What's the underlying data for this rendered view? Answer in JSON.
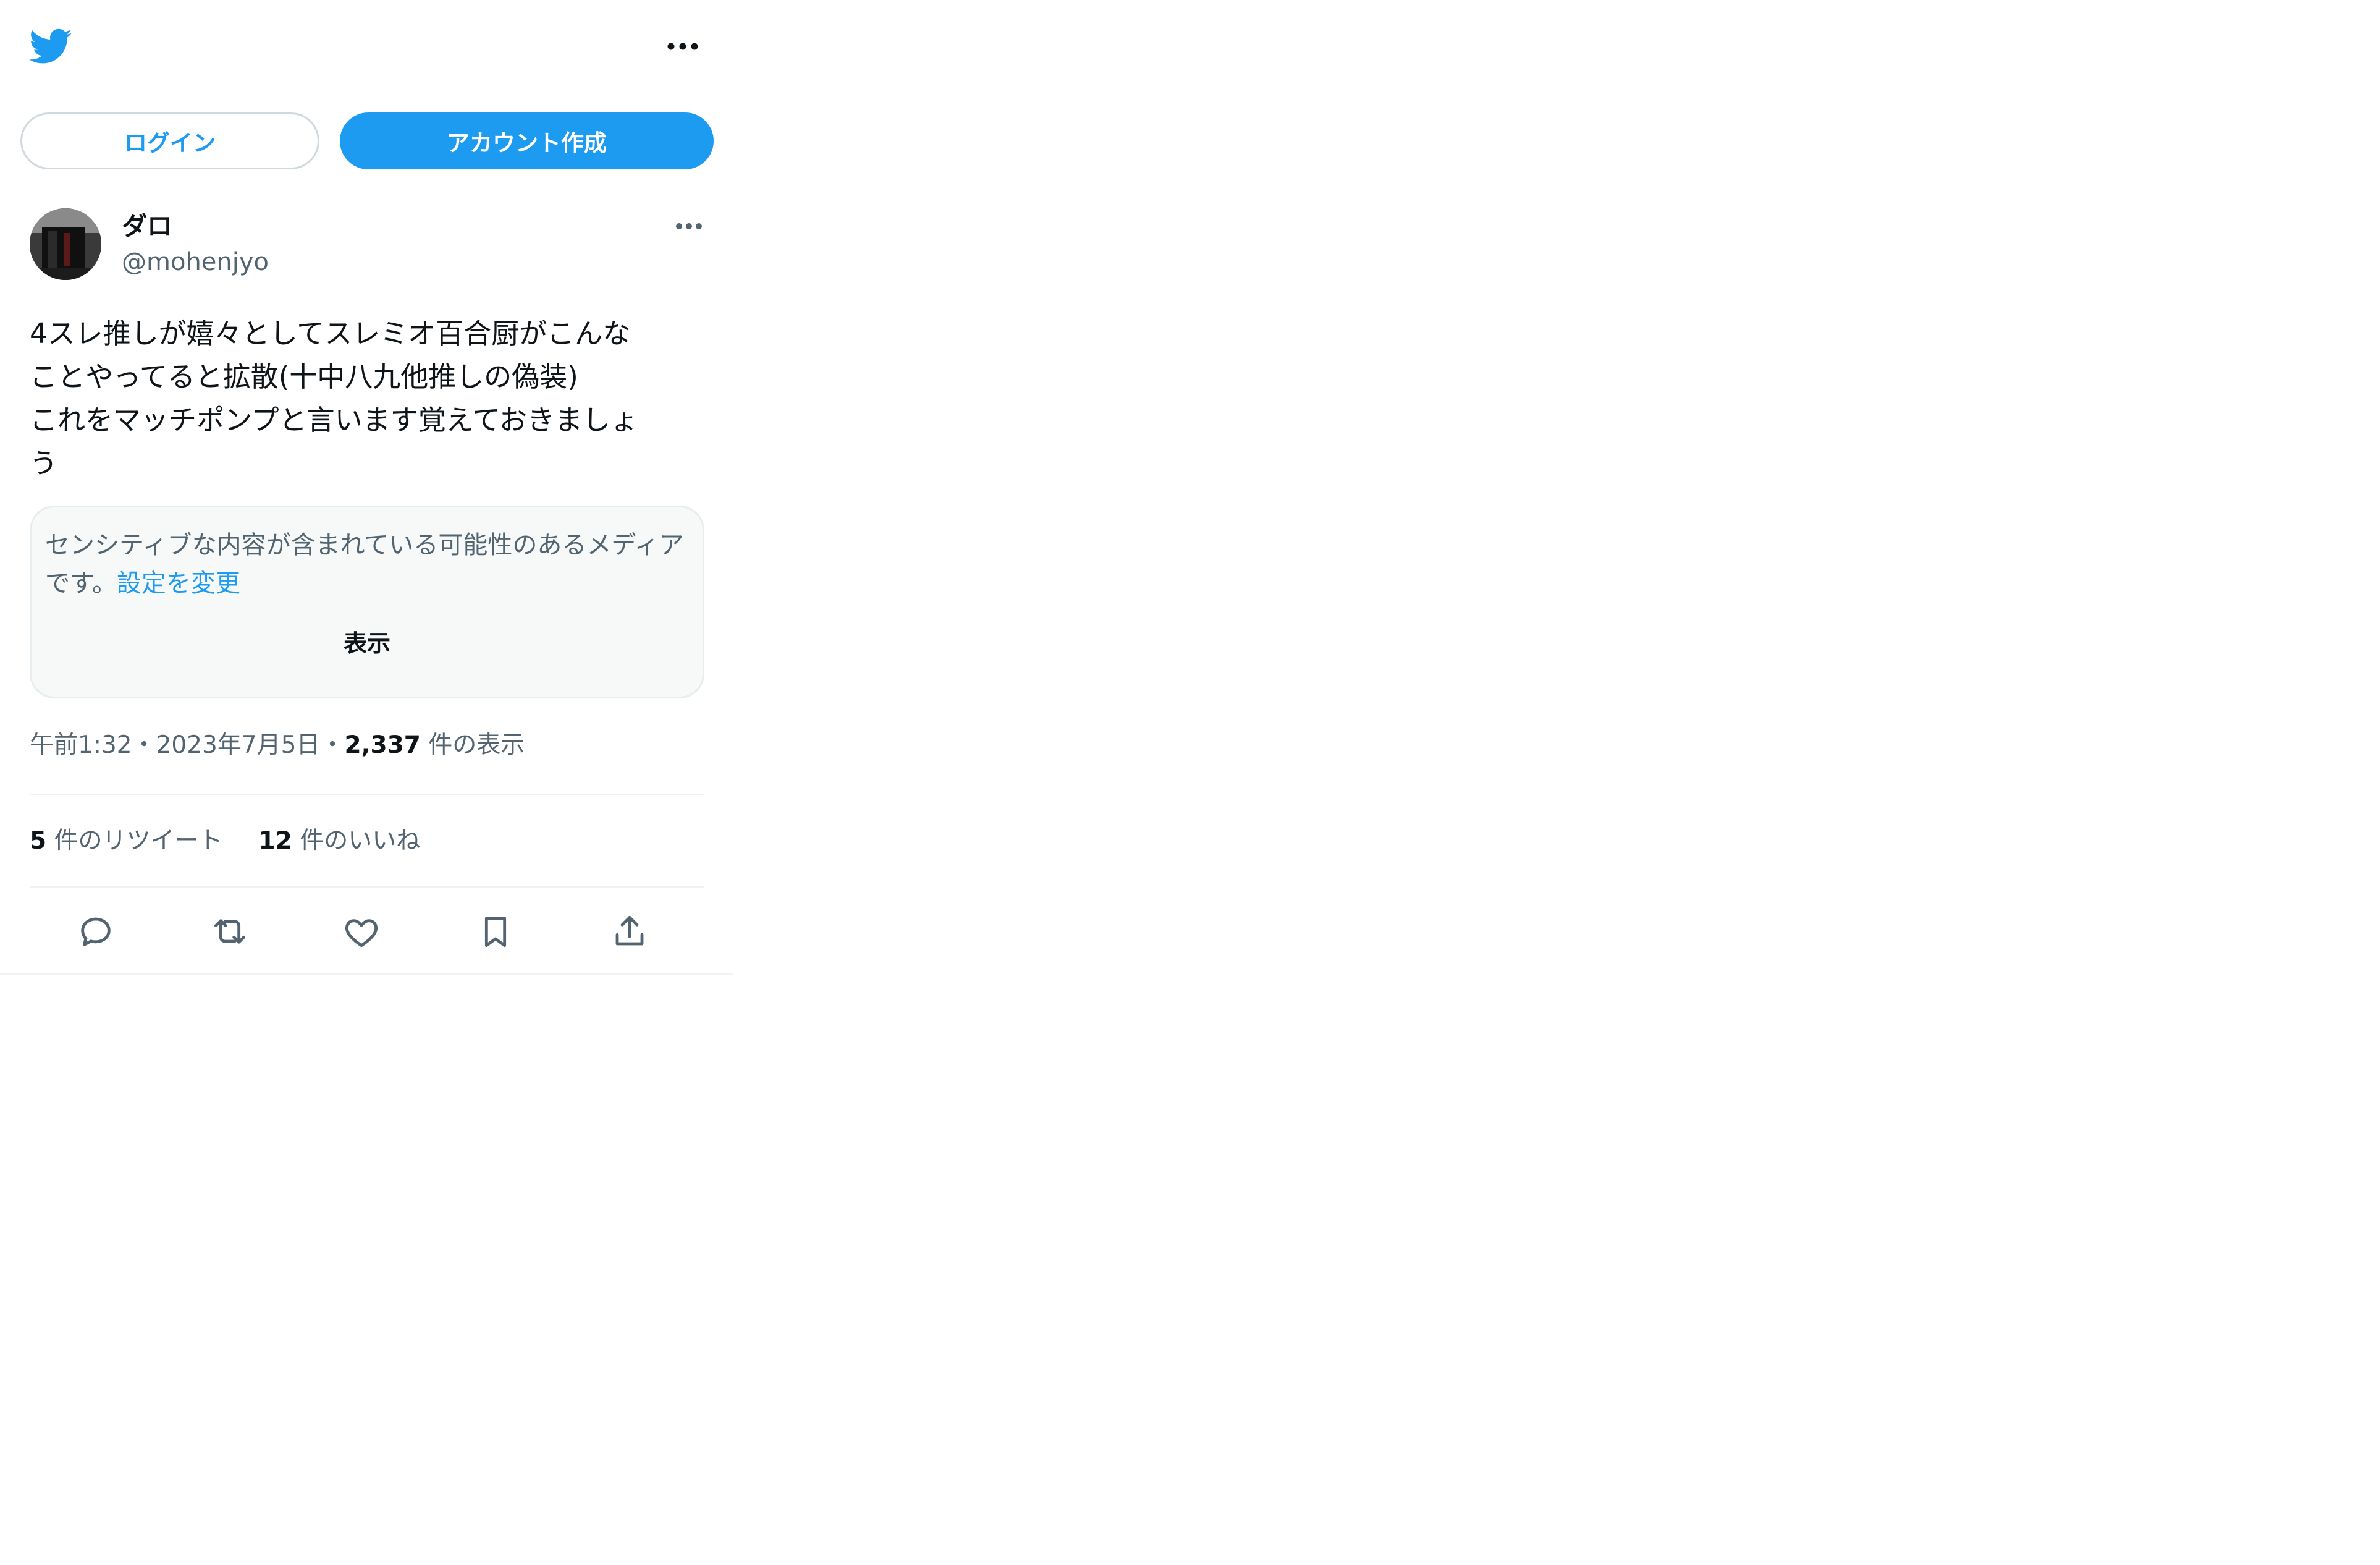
{
  "header": {
    "logo_icon": "twitter-bird-icon",
    "more_icon": "more-horizontal-icon",
    "brand_color": "#1d9bf0"
  },
  "auth": {
    "login_label": "ログイン",
    "signup_label": "アカウント作成"
  },
  "tweet": {
    "author": {
      "display_name": "ダロ",
      "handle": "@mohenjyo",
      "avatar_icon": "avatar"
    },
    "text": "4スレ推しが嬉々としてスレミオ百合厨がこんな\nことやってると拡散(十中八九他推しの偽装)\nこれをマッチポンプと言います覚えておきましょ\nう",
    "sensitive_notice": {
      "text": "センシティブな内容が含まれている可能性のあるメディアです。",
      "link_label": "設定を変更",
      "show_label": "表示"
    },
    "meta": {
      "time": "午前1:32",
      "separator": "・",
      "date": "2023年7月5日",
      "separator2": "・",
      "views_count": "2,337",
      "views_label": " 件の表示"
    },
    "stats": {
      "retweets_count": "5",
      "retweets_label": " 件のリツイート",
      "likes_count": "12",
      "likes_label": " 件のいいね"
    },
    "actions": [
      "reply-icon",
      "retweet-icon",
      "like-icon",
      "bookmark-icon",
      "share-icon"
    ]
  }
}
